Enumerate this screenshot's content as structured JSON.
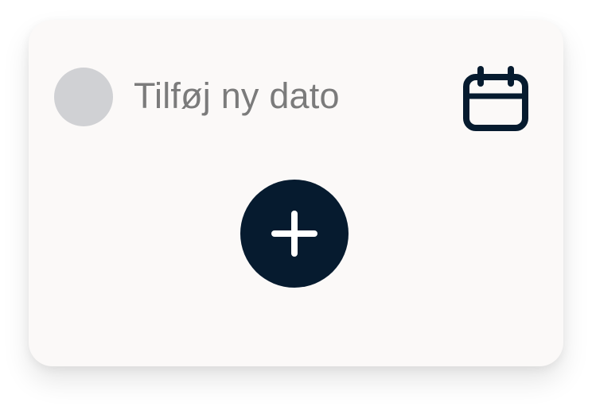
{
  "card": {
    "label": "Tilføj ny dato",
    "radio_state": "unselected",
    "calendar_icon": "calendar-icon",
    "add_icon": "plus-icon"
  },
  "colors": {
    "card_background": "#fbf9f8",
    "radio_fill": "#d0d1d4",
    "label_text": "#7b7b7b",
    "accent_dark": "#061b2f",
    "icon_on_accent": "#ffffff"
  }
}
